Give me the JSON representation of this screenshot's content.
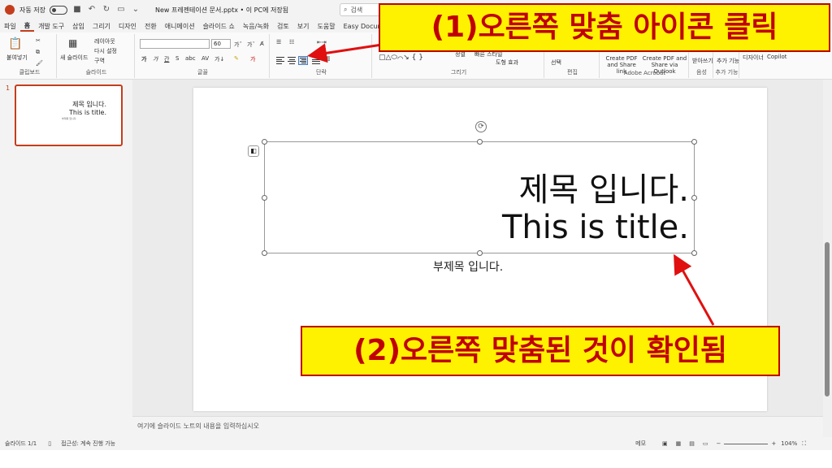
{
  "titlebar": {
    "autosave_label": "자동 저장",
    "autosave_state": "끔",
    "document_title": "New 프레젠테이션 문서.pptx • 이 PC에 저장됨",
    "search_placeholder": "검색"
  },
  "menu": {
    "tabs": [
      "파일",
      "홈",
      "개발 도구",
      "삽입",
      "그리기",
      "디자인",
      "전환",
      "애니메이션",
      "슬라이드 쇼",
      "녹음/녹화",
      "검토",
      "보기",
      "도움말",
      "Easy Document"
    ],
    "active": "홈"
  },
  "ribbon": {
    "clipboard": {
      "paste": "붙여넣기",
      "label": "클립보드"
    },
    "slides": {
      "new_slide": "새 슬라이드",
      "layout": "레이아웃",
      "reset": "다시 설정",
      "section": "구역",
      "label": "슬라이드"
    },
    "font": {
      "font_name": "",
      "font_size": "60",
      "label": "글꼴"
    },
    "paragraph": {
      "label": "단락"
    },
    "drawing": {
      "shapes": "도형",
      "arrange": "정렬",
      "quick_styles": "빠른 스타일",
      "shape_effects": "도형 효과",
      "label": "그리기"
    },
    "editing": {
      "select": "선택",
      "label": "편집"
    },
    "acrobat": {
      "create_pdf_link": "Create PDF and Share link",
      "create_pdf_outlook": "Create PDF and Share via Outlook",
      "label": "Adobe Acrobat"
    },
    "voice": {
      "dictate": "받아쓰기",
      "label": "음성"
    },
    "addins": {
      "addins": "추가 기능",
      "label": "추가 기능"
    },
    "designer": {
      "designer": "디자이너",
      "copilot": "Copilot"
    }
  },
  "thumbnails": {
    "slide_number": "1",
    "title_line1": "제목 입니다.",
    "title_line2": "This is title.",
    "subtitle": "부제목 입니다."
  },
  "slide": {
    "title_line1": "제목 입니다.",
    "title_line2": "This is title.",
    "subtitle": "부제목 입니다."
  },
  "notes": {
    "placeholder": "여기에 슬라이드 노트의 내용을 입력하십시오"
  },
  "status": {
    "slide_info": "슬라이드 1/1",
    "accessibility": "접근성: 계속 진행 가능",
    "notes_button": "메모",
    "zoom": "104%"
  },
  "callouts": {
    "step1": "(1)오른쪽 맞춤 아이콘 클릭",
    "step2": "(2)오른쪽 맞춤된 것이 확인됨"
  },
  "colors": {
    "accent": "#c43e1c",
    "callout_bg": "#fff200",
    "callout_text": "#c00000"
  }
}
